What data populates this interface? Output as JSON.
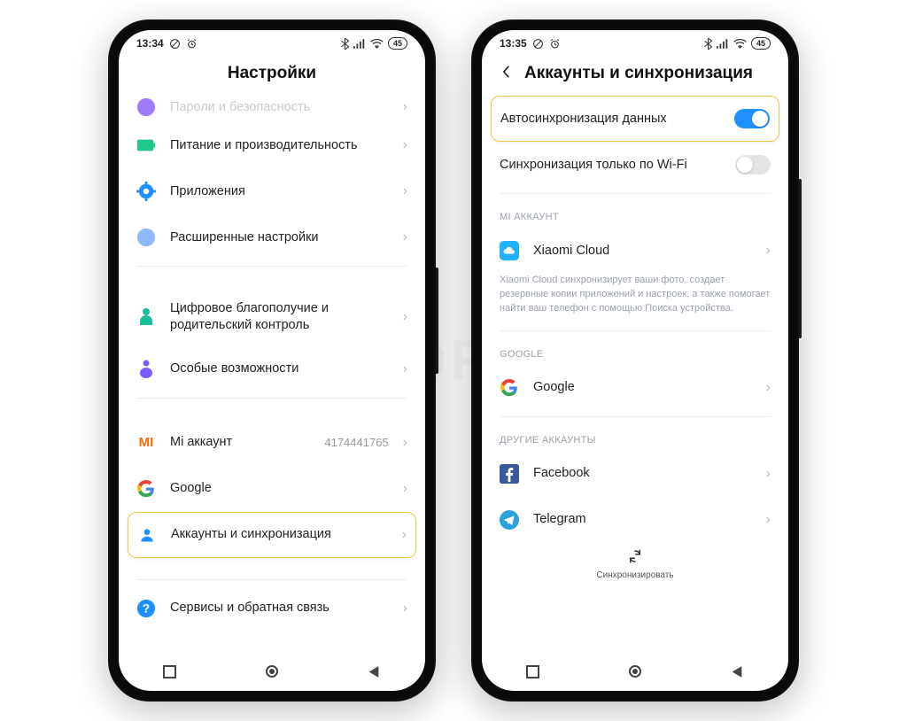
{
  "watermark": "SIBDROID",
  "phone_left": {
    "status": {
      "time": "13:34",
      "battery": "45"
    },
    "header_title": "Настройки",
    "items": {
      "passwords": {
        "label": "Пароли и безопасность"
      },
      "power": {
        "label": "Питание и производительность"
      },
      "apps": {
        "label": "Приложения"
      },
      "advanced": {
        "label": "Расширенные настройки"
      },
      "wellbeing": {
        "label": "Цифровое благополучие и родительский контроль"
      },
      "a11y": {
        "label": "Особые возможности"
      },
      "miaccount": {
        "label": "Mi аккаунт",
        "value": "4174441765"
      },
      "google": {
        "label": "Google"
      },
      "accounts": {
        "label": "Аккаунты и синхронизация"
      },
      "feedback": {
        "label": "Сервисы и обратная связь"
      }
    }
  },
  "phone_right": {
    "status": {
      "time": "13:35",
      "battery": "45"
    },
    "header_title": "Аккаунты и синхронизация",
    "toggles": {
      "autosync": {
        "label": "Автосинхронизация данных",
        "on": true
      },
      "wifionly": {
        "label": "Синхронизация только по Wi-Fi",
        "on": false
      }
    },
    "sections": {
      "mi": {
        "title": "MI АККАУНТ"
      },
      "google": {
        "title": "GOOGLE"
      },
      "other": {
        "title": "ДРУГИЕ АККАУНТЫ"
      }
    },
    "mi_cloud": {
      "label": "Xiaomi Cloud",
      "description": "Xiaomi Cloud синхронизирует ваши фото, создает резервные копии приложений и настроек, а также помогает найти ваш телефон с помощью Поиска устройства."
    },
    "google_item": {
      "label": "Google"
    },
    "other_items": {
      "facebook": {
        "label": "Facebook"
      },
      "telegram": {
        "label": "Telegram"
      }
    },
    "sync_action_label": "Синхронизировать"
  }
}
